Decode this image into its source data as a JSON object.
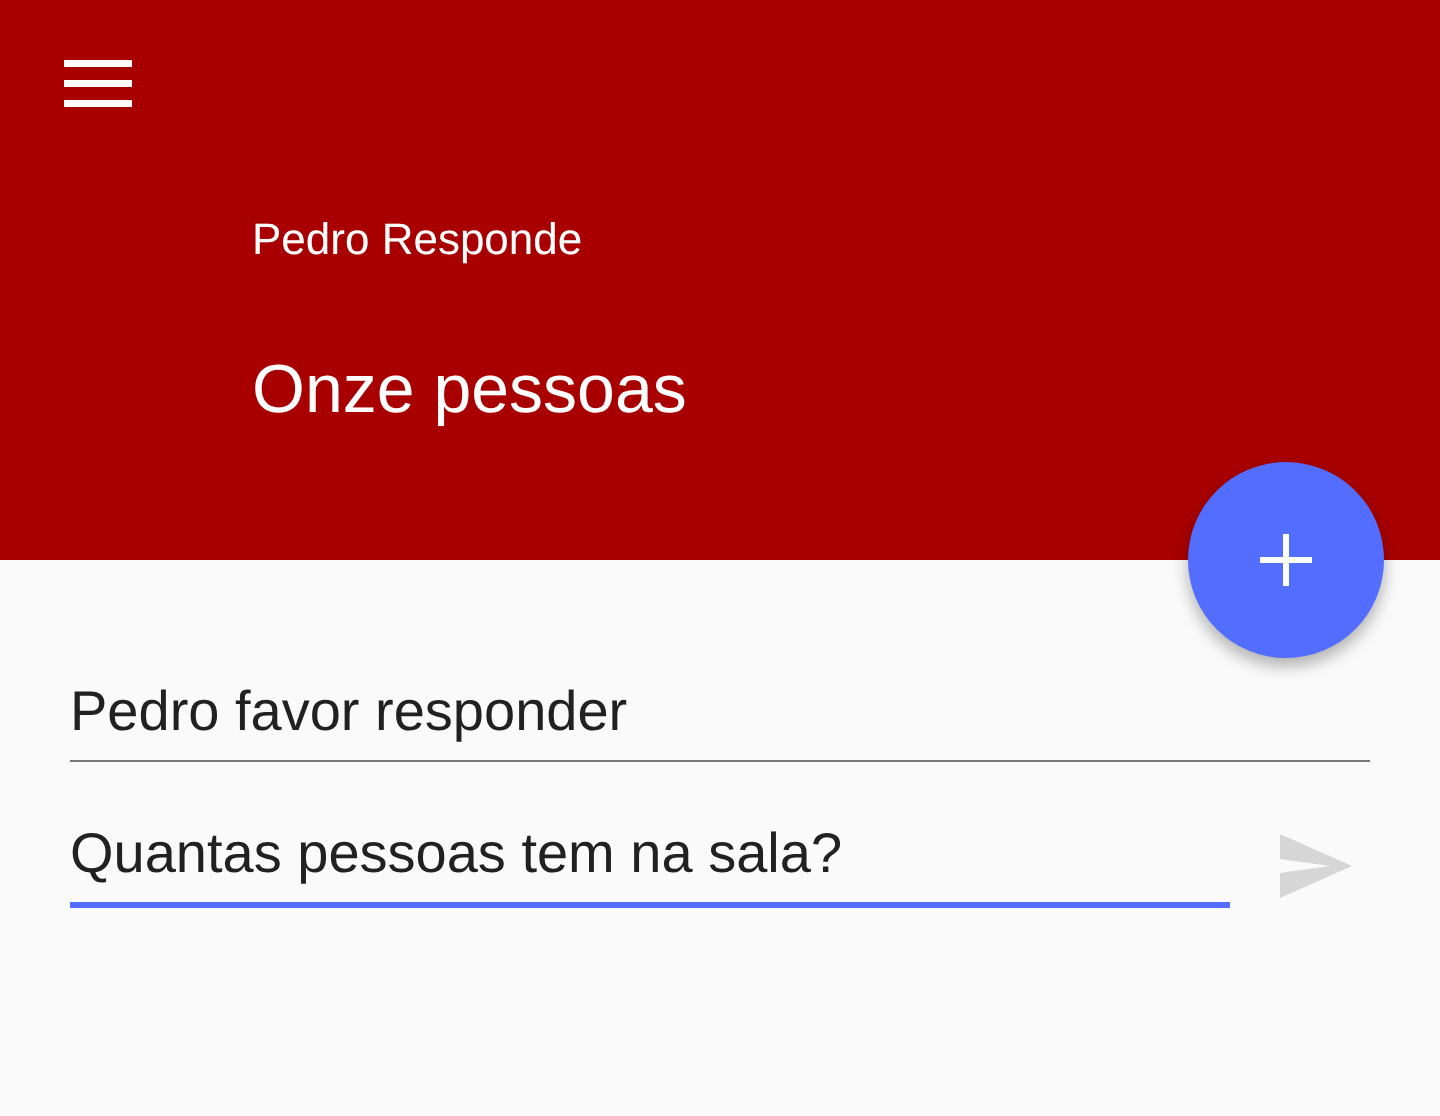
{
  "header": {
    "subtitle": "Pedro Responde",
    "title": "Onze pessoas"
  },
  "fields": [
    {
      "value": "Pedro favor responder",
      "focused": false,
      "send": false
    },
    {
      "value": "Quantas pessoas tem na sala?",
      "focused": true,
      "send": true
    }
  ],
  "send_button": {
    "disabled": true
  }
}
